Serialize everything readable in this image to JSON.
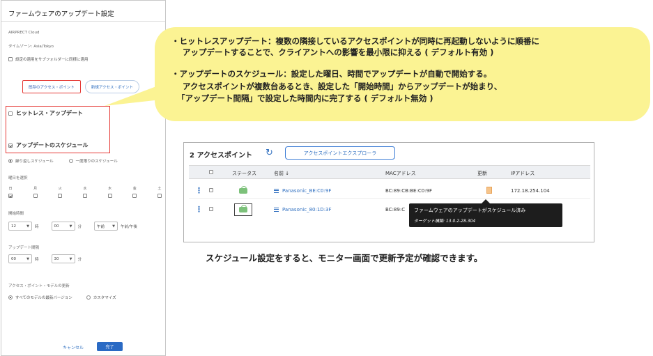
{
  "panel": {
    "title": "ファームウェアのアップデート設定",
    "site": "AIRPRECT Cloud",
    "timezone": "タイムゾーン: Asia/Tokyo",
    "apply_subfolder_label": "設定の適用をサブフォルダーに同様に適用",
    "tabs": [
      {
        "label": "既存のアクセス・ポイント"
      },
      {
        "label": "新規アクセス・ポイント"
      }
    ],
    "hitless_label": "ヒットレス・アップデート",
    "schedule_label": "アップデートのスケジュール",
    "recurrence_options": [
      {
        "label": "繰り返しスケジュール"
      },
      {
        "label": "一度限りのスケジュール"
      }
    ],
    "days_heading": "曜日を選択",
    "days": [
      "日",
      "月",
      "火",
      "水",
      "木",
      "金",
      "土"
    ],
    "start_time_heading": "開始時間",
    "start_hour": "12",
    "hour_unit": "時",
    "start_minute": "00",
    "minute_unit": "分",
    "ampm": "午前",
    "ampm_suffix": "午前/午後",
    "interval_heading": "アップデート間隔",
    "interval_hour": "00",
    "interval_minute": "30",
    "model_heading": "アクセス・ポイント・モデルの更新",
    "model_options": [
      {
        "label": "すべてのモデルの最新バージョン"
      },
      {
        "label": "カスタマイズ"
      }
    ],
    "cancel_label": "キャンセル",
    "save_label": "完了"
  },
  "callout": {
    "bullet1_line1": "・ヒットレスアップデート：複数の隣接しているアクセスポイントが同時に再起動しないように順番に",
    "bullet1_line2": "アップデートすることで、クライアントへの影響を最小限に抑える ( デフォルト有効 )",
    "bullet2_line1": "・アップデートのスケジュール：設定した曜日、時間でアップデートが自動で開始する。",
    "bullet2_line2": "アクセスポイントが複数台あるとき、設定した「開始時間」からアップデートが始まり、",
    "bullet2_line3": "「アップデート間隔」で設定した時間内に完了する ( デフォルト無効 )",
    "color": "#fbf393"
  },
  "monitor": {
    "title": "2 アクセスポイント",
    "explorer_button": "アクセスポイントエクスプローラ",
    "columns": {
      "status": "ステータス",
      "name": "名前 ↓",
      "mac": "MACアドレス",
      "update": "更新",
      "ip": "IPアドレス"
    },
    "rows": [
      {
        "name": "Panasonic_BE:C0:9F",
        "mac": "BC:89:CB:BE:C0:9F",
        "ip": "172.18.254.104"
      },
      {
        "name": "Panasonic_80:1D:3F",
        "mac": "BC:89:C",
        "ip": ""
      }
    ],
    "tooltip_line1": "ファームウェアのアップデートがスケジュール済み",
    "tooltip_line2": "ターゲット構築: 13.0.2-28.304",
    "accent_color": "#2f6fc0"
  },
  "caption": "スケジュール設定をすると、モニター画面で更新予定が確認できます。"
}
